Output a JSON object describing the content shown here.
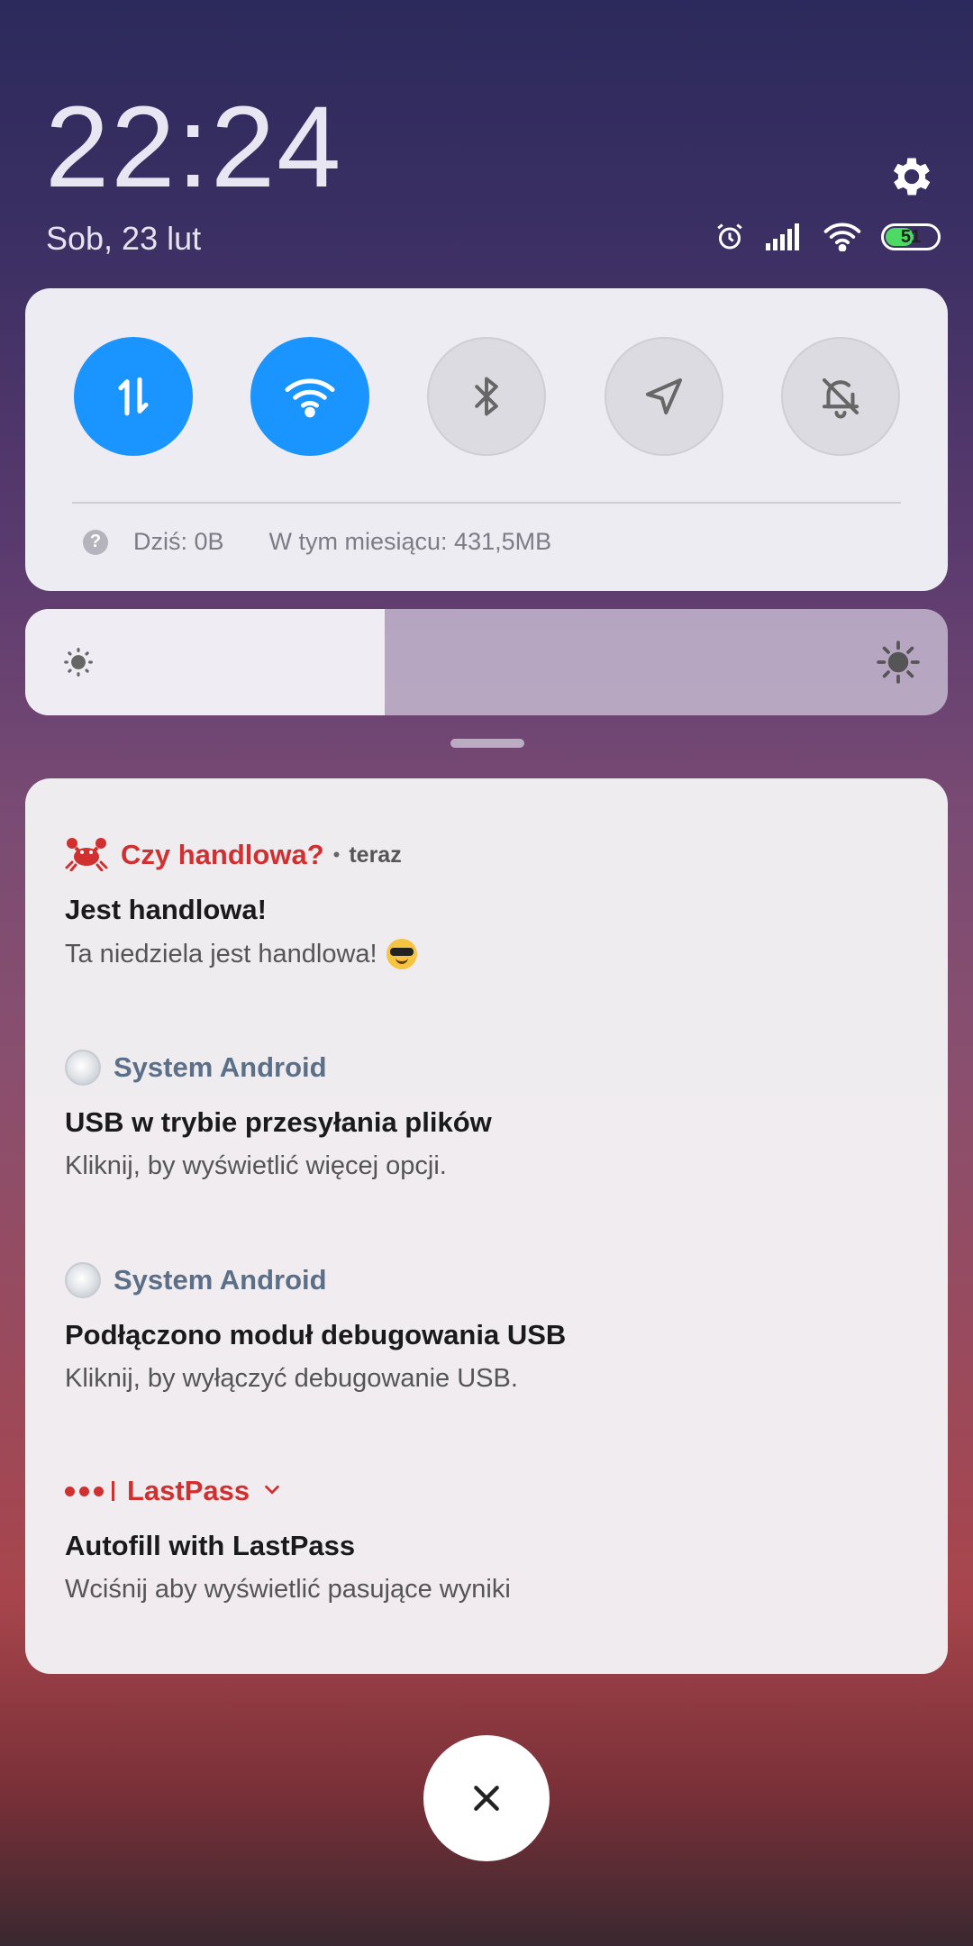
{
  "lockscreen": {
    "time": "22:24",
    "date": "Sob, 23 lut",
    "battery_level": "51"
  },
  "quick_settings": {
    "toggles": [
      {
        "name": "mobile-data",
        "state": "on"
      },
      {
        "name": "wifi",
        "state": "on"
      },
      {
        "name": "bluetooth",
        "state": "off"
      },
      {
        "name": "location",
        "state": "off"
      },
      {
        "name": "silent",
        "state": "off"
      }
    ],
    "data_today": "Dziś: 0B",
    "data_month": "W tym miesiącu: 431,5MB",
    "help_symbol": "?"
  },
  "brightness": {
    "level_percent": 39
  },
  "notifications": [
    {
      "app": "Czy handlowa?",
      "time": "teraz",
      "title": "Jest handlowa!",
      "body": "Ta niedziela jest handlowa!"
    },
    {
      "app": "System Android",
      "title": "USB w trybie przesyłania plików",
      "body": "Kliknij, by wyświetlić więcej opcji."
    },
    {
      "app": "System Android",
      "title": "Podłączono moduł debugowania USB",
      "body": "Kliknij, by wyłączyć debugowanie USB."
    },
    {
      "app": "LastPass",
      "title": "Autofill with LastPass",
      "body": "Wciśnij aby wyświetlić pasujące wyniki"
    }
  ],
  "colors": {
    "accent": "#1a94ff",
    "app_red": "#d03030",
    "system_grey": "#5b7088"
  }
}
